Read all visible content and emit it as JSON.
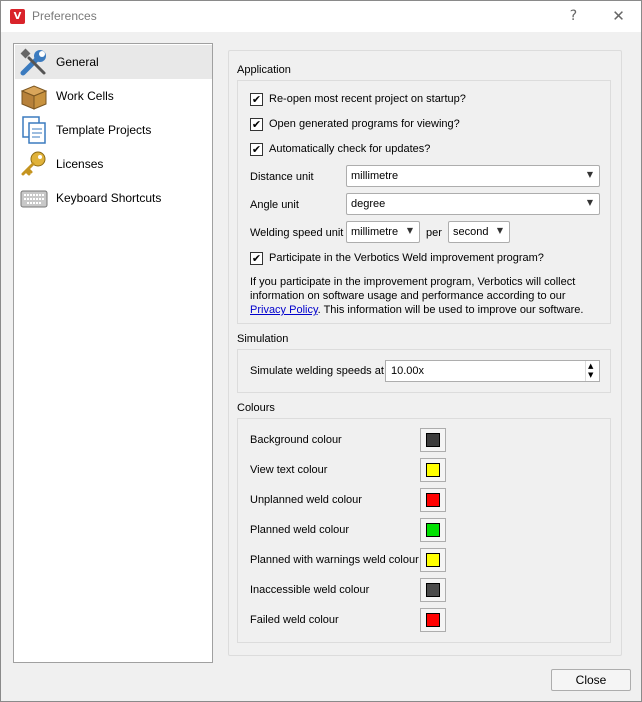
{
  "window": {
    "title": "Preferences",
    "icon_text": "V",
    "help_glyph": "?",
    "close_glyph": "✕"
  },
  "sidebar": {
    "items": [
      {
        "label": "General",
        "icon": "wrench-screwdriver-icon",
        "selected": true
      },
      {
        "label": "Work Cells",
        "icon": "box-icon",
        "selected": false
      },
      {
        "label": "Template Projects",
        "icon": "documents-icon",
        "selected": false
      },
      {
        "label": "Licenses",
        "icon": "key-icon",
        "selected": false
      },
      {
        "label": "Keyboard Shortcuts",
        "icon": "keyboard-icon",
        "selected": false
      }
    ]
  },
  "application": {
    "title": "Application",
    "reopen_label": "Re-open most recent project on startup?",
    "reopen_checked": true,
    "open_generated_label": "Open generated programs for viewing?",
    "open_generated_checked": true,
    "auto_update_label": "Automatically check for updates?",
    "auto_update_checked": true,
    "distance_unit_label": "Distance unit",
    "distance_unit_value": "millimetre",
    "angle_unit_label": "Angle unit",
    "angle_unit_value": "degree",
    "welding_speed_label": "Welding speed unit",
    "welding_speed_length": "millimetre",
    "per_label": "per",
    "welding_speed_time": "second",
    "participate_label": "Participate in the Verbotics Weld improvement program?",
    "participate_checked": true,
    "info_pre": "If you participate in the improvement program, Verbotics will collect information on software usage and performance according to our ",
    "info_link": "Privacy Policy",
    "info_post": ". This information will be used to improve our software.",
    "check_glyph": "✔"
  },
  "simulation": {
    "title": "Simulation",
    "speed_label": "Simulate welding speeds at",
    "speed_value": "10.00x"
  },
  "colours": {
    "title": "Colours",
    "rows": [
      {
        "label": "Background colour",
        "color": "#3c3c3c"
      },
      {
        "label": "View text colour",
        "color": "#ffff00"
      },
      {
        "label": "Unplanned weld colour",
        "color": "#ff0000"
      },
      {
        "label": "Planned weld colour",
        "color": "#00e000"
      },
      {
        "label": "Planned with warnings weld colour",
        "color": "#ffff00"
      },
      {
        "label": "Inaccessible weld colour",
        "color": "#4a4a4a"
      },
      {
        "label": "Failed weld colour",
        "color": "#ff0000"
      }
    ]
  },
  "footer": {
    "close_label": "Close"
  }
}
